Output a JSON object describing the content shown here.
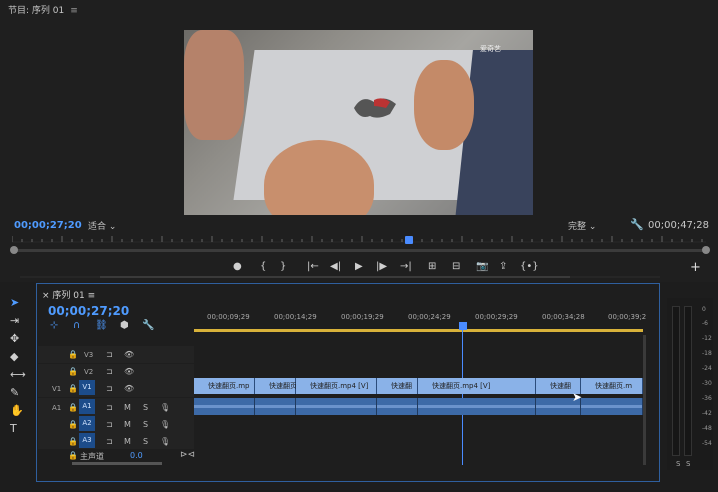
{
  "program_monitor": {
    "title": "节目: 序列 01",
    "menu_icon": "≡",
    "watermark": "爱奇艺",
    "current_timecode": "00;00;27;20",
    "fit_label": "适合",
    "quality_label": "完整",
    "duration_timecode": "00;00;47;28",
    "transport": [
      "●",
      "{",
      "}",
      "|←",
      "◀|",
      "▶",
      "|▶",
      "→|",
      "⊞",
      "⊟",
      "📷",
      "⇪",
      "{•}"
    ],
    "add_label": "+"
  },
  "tools": [
    "selection-tool",
    "track-select-tool",
    "ripple-edit-tool",
    "razor-tool",
    "slip-tool",
    "pen-tool",
    "hand-tool",
    "type-tool"
  ],
  "timeline": {
    "tab_title": "序列 01",
    "menu_icon": "≡",
    "timecode": "00;00;27;20",
    "ruler_ticks": [
      "00;00;09;29",
      "00;00;14;29",
      "00;00;19;29",
      "00;00;24;29",
      "00;00;29;29",
      "00;00;34;28",
      "00;00;39;2"
    ],
    "video_tracks": [
      {
        "name": "V3"
      },
      {
        "name": "V2"
      },
      {
        "name": "V1",
        "src": "V1"
      }
    ],
    "audio_tracks": [
      {
        "name": "A1",
        "src": "A1"
      },
      {
        "name": "A2"
      },
      {
        "name": "A3"
      }
    ],
    "master_label": "主声道",
    "master_value": "0.0",
    "clip_labels": [
      "快速翻页.mp",
      "快速翻页.mp",
      "快速翻页.mp4 [V]",
      "快速翻",
      "快速翻页.mp4 [V]",
      "快速翻",
      "快速翻页.m"
    ]
  },
  "meter": {
    "db_labels": [
      "0",
      "-6",
      "-12",
      "-18",
      "-24",
      "-30",
      "-36",
      "-42",
      "-48",
      "-54"
    ],
    "s_label": "S"
  }
}
